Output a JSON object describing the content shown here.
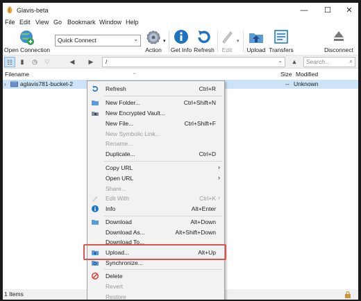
{
  "window": {
    "title": "Glavis-beta",
    "minimize": "—",
    "maximize": "☐",
    "close": "✕"
  },
  "menu": [
    "File",
    "Edit",
    "View",
    "Go",
    "Bookmark",
    "Window",
    "Help"
  ],
  "toolbar": {
    "open_connection": "Open Connection",
    "quick_connect": "Quick Connect",
    "action": "Action",
    "get_info": "Get Info",
    "refresh": "Refresh",
    "edit": "Edit",
    "upload": "Upload",
    "transfers": "Transfers",
    "disconnect": "Disconnect"
  },
  "navbar": {
    "path": "/",
    "search_placeholder": "Search..."
  },
  "columns": {
    "filename": "Filename",
    "size": "Size",
    "modified": "Modified"
  },
  "file": {
    "name": "aglavis781-bucket-2",
    "size": "--",
    "modified": "Unknown"
  },
  "context_menu": [
    {
      "label": "Refresh",
      "shortcut": "Ctrl+R",
      "icon": "refresh-icon",
      "enabled": true
    },
    {
      "label": "New Folder...",
      "shortcut": "Ctrl+Shift+N",
      "icon": "folder-icon",
      "enabled": true
    },
    {
      "label": "New Encrypted Vault...",
      "shortcut": "",
      "icon": "vault-icon",
      "enabled": true
    },
    {
      "label": "New File...",
      "shortcut": "Ctrl+Shift+F",
      "icon": "",
      "enabled": true
    },
    {
      "label": "New Symbolic Link...",
      "shortcut": "",
      "icon": "",
      "enabled": false
    },
    {
      "label": "Rename...",
      "shortcut": "",
      "icon": "",
      "enabled": false
    },
    {
      "label": "Duplicate...",
      "shortcut": "Ctrl+D",
      "icon": "",
      "enabled": true
    },
    {
      "label": "Copy URL",
      "shortcut": "",
      "icon": "",
      "enabled": true,
      "submenu": true
    },
    {
      "label": "Open URL",
      "shortcut": "",
      "icon": "",
      "enabled": true,
      "submenu": true
    },
    {
      "label": "Share...",
      "shortcut": "",
      "icon": "",
      "enabled": false
    },
    {
      "label": "Edit With",
      "shortcut": "Ctrl+K",
      "icon": "pencil-icon",
      "enabled": false,
      "submenu": true
    },
    {
      "label": "Info",
      "shortcut": "Alt+Enter",
      "icon": "info-icon",
      "enabled": true
    },
    {
      "label": "Download",
      "shortcut": "Alt+Down",
      "icon": "download-icon",
      "enabled": true
    },
    {
      "label": "Download As...",
      "shortcut": "Alt+Shift+Down",
      "icon": "",
      "enabled": true
    },
    {
      "label": "Download To...",
      "shortcut": "",
      "icon": "",
      "enabled": true
    },
    {
      "label": "Upload...",
      "shortcut": "Alt+Up",
      "icon": "upload-icon",
      "enabled": true
    },
    {
      "label": "Synchronize...",
      "shortcut": "",
      "icon": "sync-icon",
      "enabled": true
    },
    {
      "label": "Delete",
      "shortcut": "",
      "icon": "delete-icon",
      "enabled": true
    },
    {
      "label": "Revert",
      "shortcut": "",
      "icon": "",
      "enabled": false
    },
    {
      "label": "Restore",
      "shortcut": "",
      "icon": "",
      "enabled": false
    }
  ],
  "status": {
    "items": "1 Items"
  },
  "colors": {
    "highlight_border": "#d9534f",
    "selected_row": "#cce4f7",
    "accent_blue": "#1e73be"
  }
}
